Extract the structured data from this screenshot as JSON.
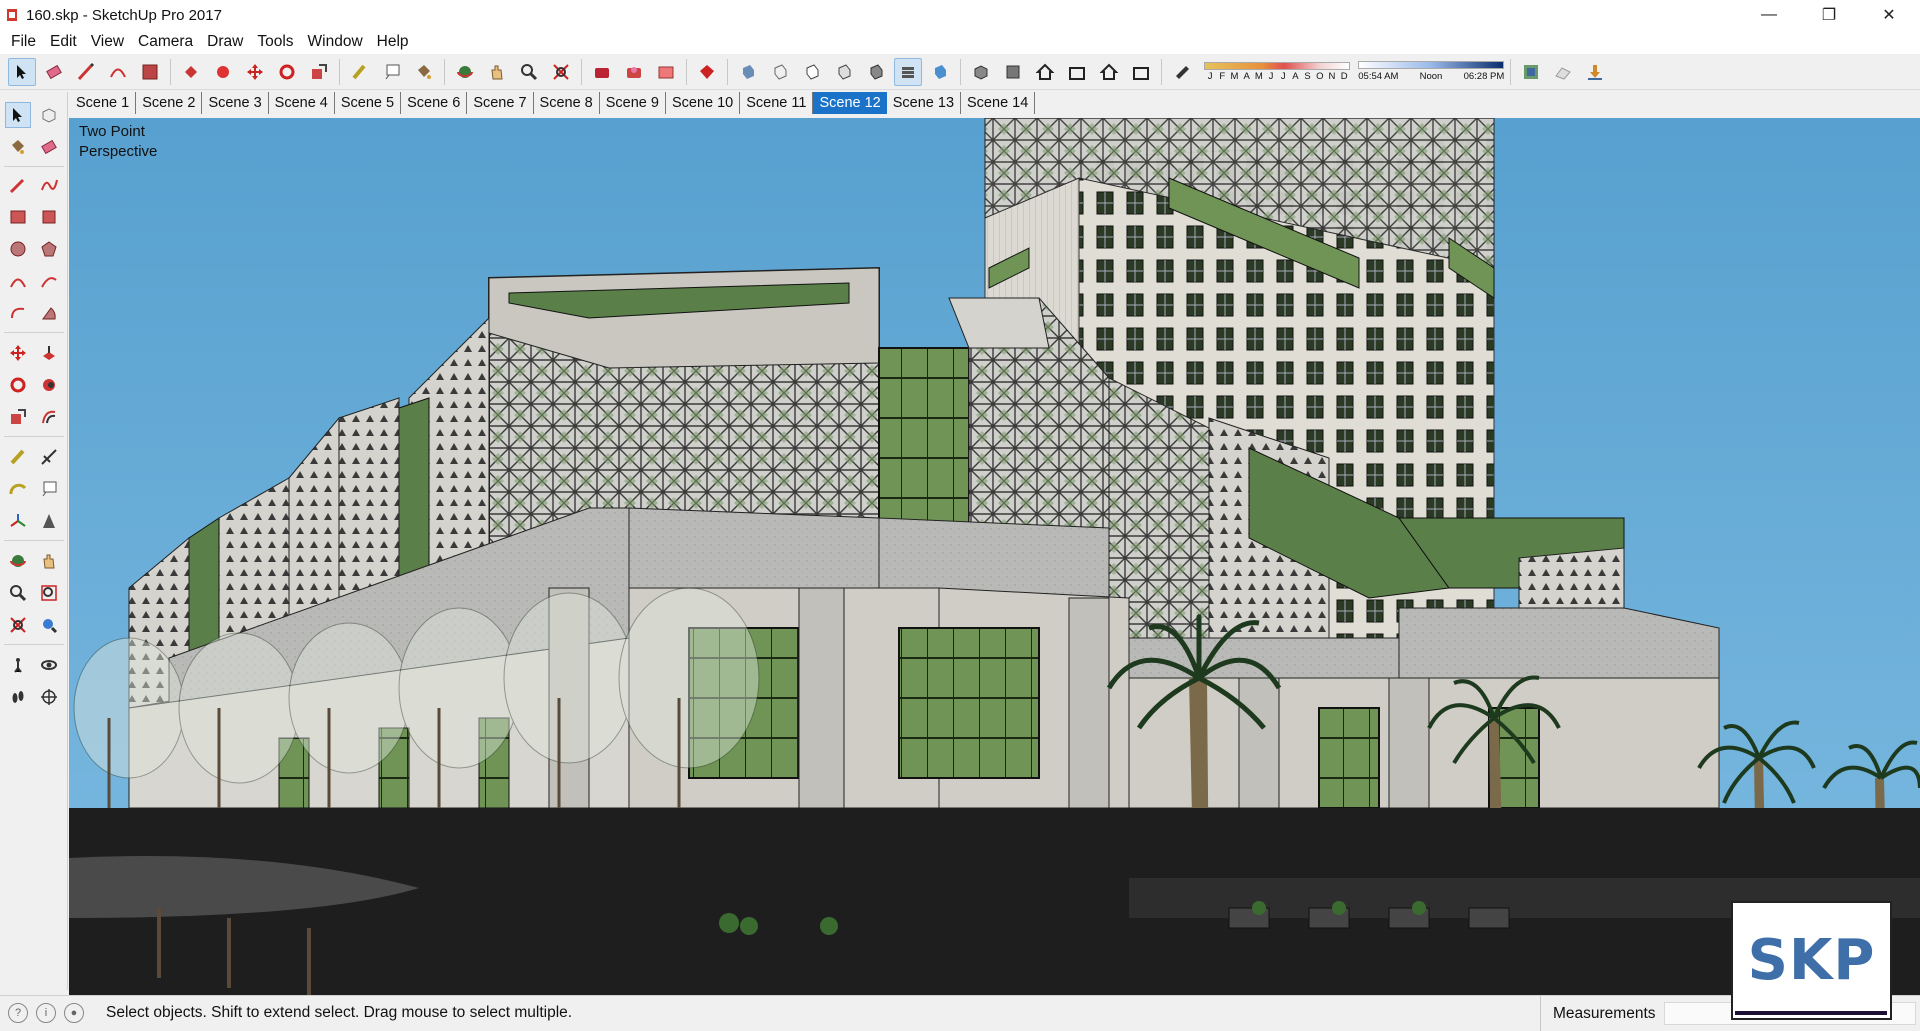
{
  "window": {
    "title": "160.skp - SketchUp Pro 2017",
    "controls": {
      "minimize": "—",
      "maximize": "❐",
      "close": "✕"
    }
  },
  "menu": [
    "File",
    "Edit",
    "View",
    "Camera",
    "Draw",
    "Tools",
    "Window",
    "Help"
  ],
  "toolbar": {
    "shadow_settings": {
      "months": [
        "J",
        "F",
        "M",
        "A",
        "M",
        "J",
        "J",
        "A",
        "S",
        "O",
        "N",
        "D"
      ],
      "time_start": "05:54 AM",
      "time_mid": "Noon",
      "time_end": "06:28 PM"
    }
  },
  "scenes": {
    "tabs": [
      "Scene 1",
      "Scene 2",
      "Scene 3",
      "Scene 4",
      "Scene 5",
      "Scene 6",
      "Scene 7",
      "Scene 8",
      "Scene 9",
      "Scene 10",
      "Scene 11",
      "Scene 12",
      "Scene 13",
      "Scene 14"
    ],
    "active": "Scene 12"
  },
  "viewport": {
    "camera_label_line1": "Two Point",
    "camera_label_line2": "Perspective"
  },
  "status": {
    "message": "Select objects. Shift to extend select. Drag mouse to select multiple.",
    "measurements_label": "Measurements",
    "measurements_value": ""
  },
  "watermark": "SKP",
  "colors": {
    "sky": "#5ea3cf",
    "glass": "#5f8a4a",
    "active_scene": "#1a73c9",
    "concrete": "#b8b8b6",
    "tower": "#deddd6"
  }
}
